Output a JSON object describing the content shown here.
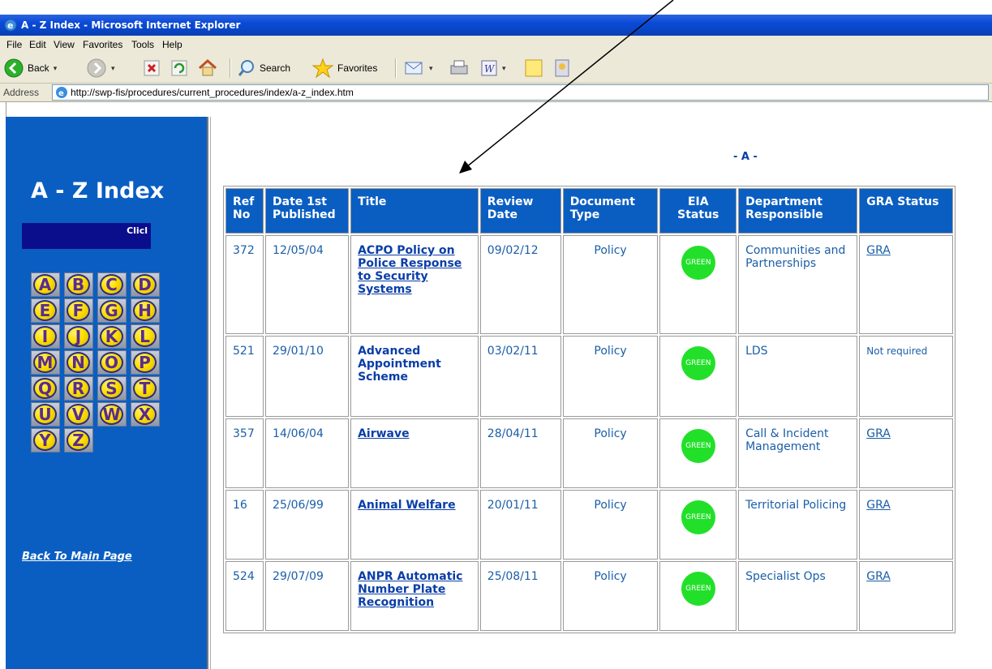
{
  "window": {
    "title": "A - Z Index - Microsoft Internet Explorer"
  },
  "menu": [
    "File",
    "Edit",
    "View",
    "Favorites",
    "Tools",
    "Help"
  ],
  "toolbar": {
    "back": "Back",
    "search": "Search",
    "favorites": "Favorites"
  },
  "address": {
    "label": "Address",
    "url": "http://swp-fis/procedures/current_procedures/index/a-z_index.htm"
  },
  "sidebar": {
    "title": "A - Z Index",
    "marquee": "Clicl",
    "letters": [
      "A",
      "B",
      "C",
      "D",
      "E",
      "F",
      "G",
      "H",
      "I",
      "J",
      "K",
      "L",
      "M",
      "N",
      "O",
      "P",
      "Q",
      "R",
      "S",
      "T",
      "U",
      "V",
      "W",
      "X",
      "Y",
      "Z"
    ],
    "back_link": "Back To Main Page"
  },
  "main": {
    "section_letter": "- A -",
    "headers": [
      "Ref No",
      "Date 1st Published",
      "Title",
      "Review Date",
      "Document Type",
      "EIA Status",
      "Department Responsible",
      "GRA Status"
    ],
    "rows": [
      {
        "ref": "372",
        "date": "12/05/04",
        "title": "ACPO Policy on Police Response to Security Systems",
        "title_link": true,
        "review": "09/02/12",
        "type": "Policy",
        "eia": "GREEN",
        "dept": "Communities and Partnerships",
        "gra": "GRA",
        "gra_link": true
      },
      {
        "ref": "521",
        "date": "29/01/10",
        "title": "Advanced Appointment Scheme",
        "title_link": false,
        "review": "03/02/11",
        "type": "Policy",
        "eia": "GREEN",
        "dept": "LDS",
        "gra": "Not required",
        "gra_link": false
      },
      {
        "ref": "357",
        "date": "14/06/04",
        "title": "Airwave",
        "title_link": true,
        "review": "28/04/11",
        "type": "Policy",
        "eia": "GREEN",
        "dept": "Call & Incident Management",
        "gra": "GRA",
        "gra_link": true
      },
      {
        "ref": "16",
        "date": "25/06/99",
        "title": "Animal Welfare",
        "title_link": true,
        "review": "20/01/11",
        "type": "Policy",
        "eia": "GREEN",
        "dept": "Territorial Policing",
        "gra": "GRA",
        "gra_link": true
      },
      {
        "ref": "524",
        "date": "29/07/09",
        "title": "ANPR Automatic Number Plate Recognition",
        "title_link": true,
        "review": "25/08/11",
        "type": "Policy",
        "eia": "GREEN",
        "dept": "Specialist Ops",
        "gra": "GRA",
        "gra_link": true
      }
    ]
  },
  "colors": {
    "sidebar_bg": "#0a5ec2",
    "header_bg": "#0a5ec2",
    "eia_green": "#22e02a",
    "link": "#0a3ea8"
  }
}
